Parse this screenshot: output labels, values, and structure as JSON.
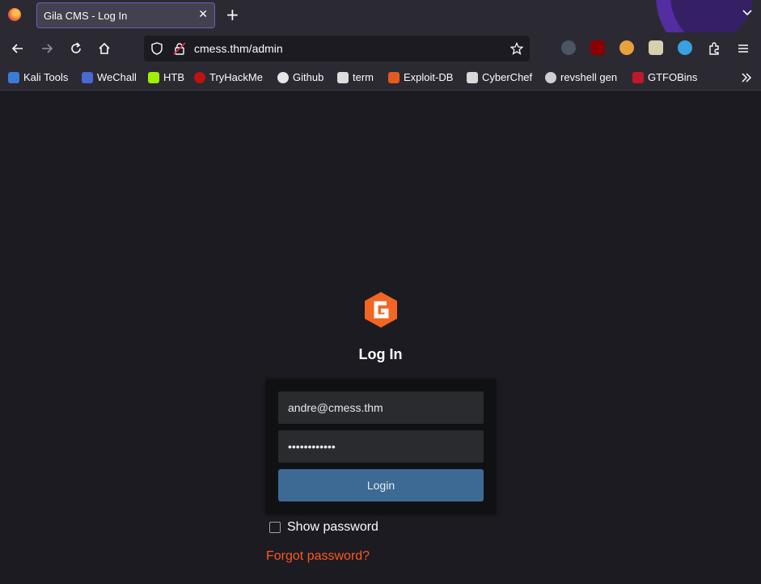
{
  "browser": {
    "tab": {
      "title": "Gila CMS - Log In",
      "close_glyph": "✕"
    },
    "new_tab_glyph": "+",
    "url": "cmess.thm/admin",
    "bookmarks": [
      {
        "label": "Kali Tools",
        "icon": "kali-icon",
        "color": "#3b7bd6"
      },
      {
        "label": "WeChall",
        "icon": "wechall-icon",
        "color": "#4a6ad0"
      },
      {
        "label": "HTB",
        "icon": "htb-icon",
        "color": "#9fef00"
      },
      {
        "label": "TryHackMe",
        "icon": "tryhackme-icon",
        "color": "#c11111"
      },
      {
        "label": "Github",
        "icon": "github-icon",
        "color": "#e6e6e6"
      },
      {
        "label": "term",
        "icon": "term-icon",
        "color": "#dddddd"
      },
      {
        "label": "Exploit-DB",
        "icon": "exploitdb-icon",
        "color": "#e25a1c"
      },
      {
        "label": "CyberChef",
        "icon": "cyberchef-icon",
        "color": "#d9d9d9"
      },
      {
        "label": "revshell gen",
        "icon": "skull-icon",
        "color": "#cfcfcf"
      },
      {
        "label": "GTFOBins",
        "icon": "gtfobins-icon",
        "color": "#c0182a"
      }
    ]
  },
  "login": {
    "heading": "Log In",
    "email_value": "andre@cmess.thm",
    "password_value": "••••••••••••",
    "login_label": "Login",
    "show_password_label": "Show password",
    "forgot_label": "Forgot password?"
  },
  "colors": {
    "accent": "#ff5722",
    "button": "#3c6a94",
    "logo": "#f26522"
  }
}
